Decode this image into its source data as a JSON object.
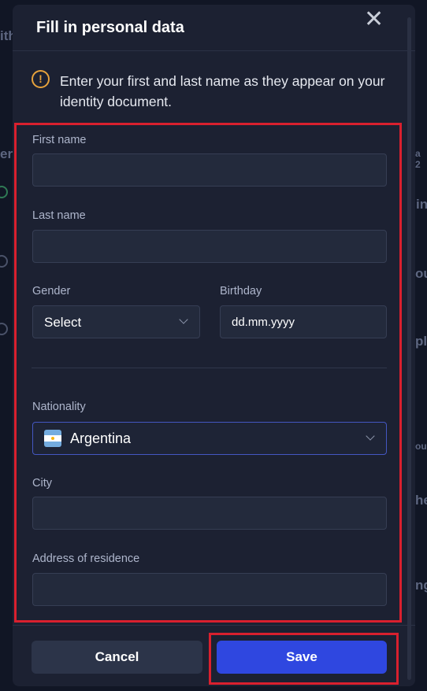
{
  "background": {
    "fragments": [
      "ith",
      "er",
      "in",
      "ou",
      "ple",
      "ou",
      "he",
      "ng",
      "a 2"
    ]
  },
  "modal": {
    "title": "Fill in personal data",
    "close_glyph": "✕",
    "notice": {
      "icon": "exclamation-circle-icon",
      "glyph": "!",
      "text": "Enter your first and last name as they appear on your identity document."
    },
    "form": {
      "first_name": {
        "label": "First name",
        "value": ""
      },
      "last_name": {
        "label": "Last name",
        "value": ""
      },
      "gender": {
        "label": "Gender",
        "selected": "Select"
      },
      "birthday": {
        "label": "Birthday",
        "placeholder": "dd.mm.yyyy"
      },
      "nationality": {
        "label": "Nationality",
        "selected": "Argentina",
        "flag": "argentina-flag-icon"
      },
      "city": {
        "label": "City",
        "value": ""
      },
      "address": {
        "label": "Address of residence",
        "value": ""
      }
    },
    "buttons": {
      "cancel": "Cancel",
      "save": "Save"
    }
  },
  "colors": {
    "modal_bg": "#1c2132",
    "field_bg": "#232a3c",
    "accent_blue": "#2f47e0",
    "warning_orange": "#e6a23c",
    "highlight_red": "#d9202e"
  }
}
